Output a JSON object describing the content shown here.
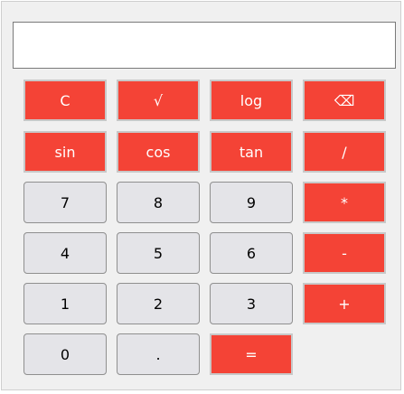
{
  "display": {
    "value": ""
  },
  "keys": {
    "clear": "C",
    "sqrt": "√",
    "log": "log",
    "backspace": "⌫",
    "sin": "sin",
    "cos": "cos",
    "tan": "tan",
    "divide": "/",
    "seven": "7",
    "eight": "8",
    "nine": "9",
    "multiply": "*",
    "four": "4",
    "five": "5",
    "six": "6",
    "subtract": "-",
    "one": "1",
    "two": "2",
    "three": "3",
    "add": "+",
    "zero": "0",
    "decimal": ".",
    "equals": "="
  },
  "colors": {
    "operator_red": "#f44336",
    "digit_gray": "#e4e4e8",
    "window_bg": "#f0f0f0"
  }
}
